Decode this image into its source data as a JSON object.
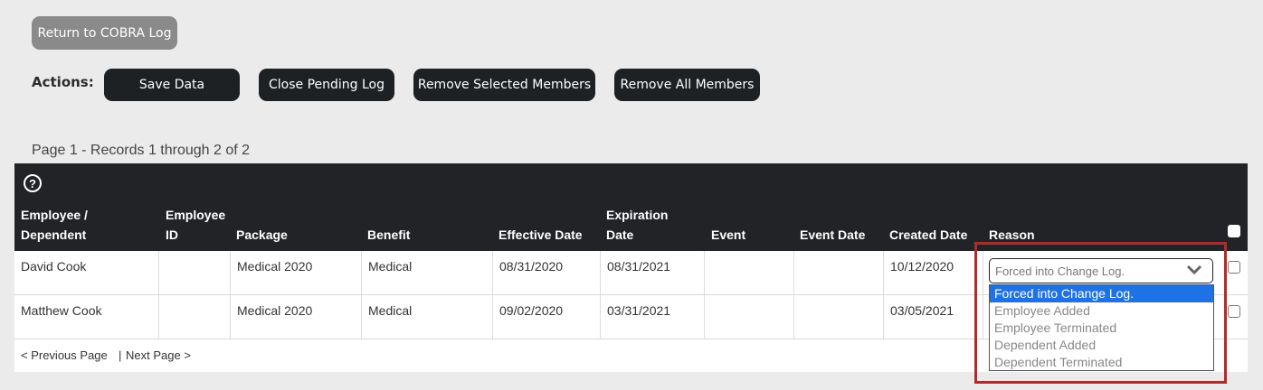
{
  "top_button": {
    "label": "Return to COBRA Log"
  },
  "actions": {
    "label": "Actions:",
    "buttons": [
      "Save Data",
      "Close Pending Log",
      "Remove Selected Members",
      "Remove All Members"
    ]
  },
  "page_info": "Page 1 - Records 1 through 2 of 2",
  "table": {
    "help_icon": "?",
    "columns": [
      {
        "line1": "Employee /",
        "line2": "Dependent"
      },
      {
        "line1": "Employee",
        "line2": "ID"
      },
      {
        "line1": "",
        "line2": "Package"
      },
      {
        "line1": "",
        "line2": "Benefit"
      },
      {
        "line1": "",
        "line2": "Effective Date"
      },
      {
        "line1": "Expiration",
        "line2": "Date"
      },
      {
        "line1": "",
        "line2": "Event"
      },
      {
        "line1": "",
        "line2": "Event Date"
      },
      {
        "line1": "",
        "line2": "Created Date"
      },
      {
        "line1": "",
        "line2": "Reason"
      }
    ],
    "rows": [
      {
        "name": "David Cook",
        "employee_id": "",
        "package": "Medical 2020",
        "benefit": "Medical",
        "effective": "08/31/2020",
        "expiration": "08/31/2021",
        "event": "",
        "event_date": "",
        "created": "10/12/2020"
      },
      {
        "name": "Matthew Cook",
        "employee_id": "",
        "package": "Medical 2020",
        "benefit": "Medical",
        "effective": "09/02/2020",
        "expiration": "03/31/2021",
        "event": "",
        "event_date": "",
        "created": "03/05/2021"
      }
    ],
    "pager": {
      "prev": "< Previous Page",
      "sep": "|",
      "next": "Next Page >"
    }
  },
  "reason_select": {
    "value": "Forced into Change Log.",
    "options": [
      "Forced into Change Log.",
      "Employee Added",
      "Employee Terminated",
      "Dependent Added",
      "Dependent Terminated"
    ]
  },
  "colors": {
    "highlight_border": "#b22a2a",
    "selected_option": "#1e72e8",
    "header_bg": "#222326"
  }
}
